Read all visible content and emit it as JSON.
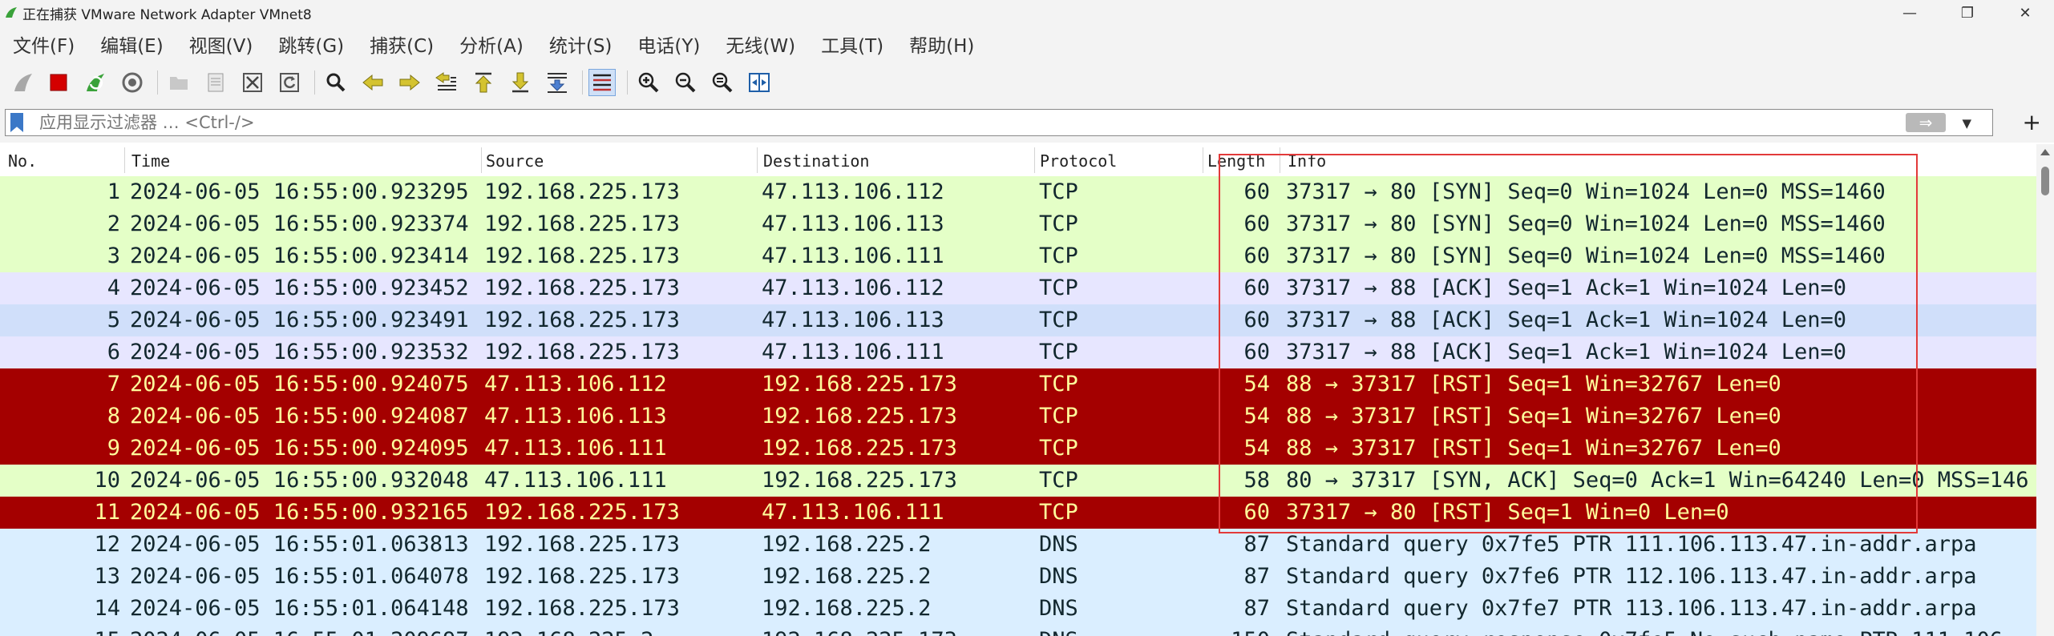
{
  "window": {
    "title": "正在捕获 VMware Network Adapter VMnet8",
    "controls": [
      "—",
      "❐",
      "✕"
    ]
  },
  "menu": {
    "items": [
      "文件(F)",
      "编辑(E)",
      "视图(V)",
      "跳转(G)",
      "捕获(C)",
      "分析(A)",
      "统计(S)",
      "电话(Y)",
      "无线(W)",
      "工具(T)",
      "帮助(H)"
    ]
  },
  "toolbar": {
    "icons": [
      "shark-fin-icon",
      "stop-icon",
      "restart-icon",
      "capture-options-icon",
      "open-folder-icon",
      "file-icon",
      "close-file-icon",
      "reload-icon",
      "search-icon",
      "back-arrow-icon",
      "forward-arrow-icon",
      "goto-packet-icon",
      "first-packet-icon",
      "last-packet-icon",
      "autoscroll-icon",
      "colorize-icon",
      "zoom-in-icon",
      "zoom-out-icon",
      "zoom-reset-icon",
      "resize-columns-icon"
    ]
  },
  "filter": {
    "placeholder": "应用显示过滤器 … <Ctrl-/>",
    "apply_label": "⇒",
    "add_label": "+"
  },
  "columns": {
    "no": "No.",
    "time": "Time",
    "source": "Source",
    "destination": "Destination",
    "protocol": "Protocol",
    "length": "Length",
    "info": "Info"
  },
  "colors": {
    "syn_bg": "#e4ffc7",
    "ack_bg": "#e7e6ff",
    "ack_selected_bg": "#d0dffa",
    "rst_bg": "#a40000",
    "rst_fg": "#fffc9c",
    "dns_bg": "#daeeff",
    "normal_fg": "#12272e",
    "highlight": "#e23a3a"
  },
  "packets": [
    {
      "no": "1",
      "time": "2024-06-05 16:55:00.923295",
      "src": "192.168.225.173",
      "dst": "47.113.106.112",
      "proto": "TCP",
      "len": "60",
      "info": "37317 → 80 [SYN] Seq=0 Win=1024 Len=0 MSS=1460",
      "bg": "#e4ffc7",
      "fg": "#12272e"
    },
    {
      "no": "2",
      "time": "2024-06-05 16:55:00.923374",
      "src": "192.168.225.173",
      "dst": "47.113.106.113",
      "proto": "TCP",
      "len": "60",
      "info": "37317 → 80 [SYN] Seq=0 Win=1024 Len=0 MSS=1460",
      "bg": "#e4ffc7",
      "fg": "#12272e"
    },
    {
      "no": "3",
      "time": "2024-06-05 16:55:00.923414",
      "src": "192.168.225.173",
      "dst": "47.113.106.111",
      "proto": "TCP",
      "len": "60",
      "info": "37317 → 80 [SYN] Seq=0 Win=1024 Len=0 MSS=1460",
      "bg": "#e4ffc7",
      "fg": "#12272e"
    },
    {
      "no": "4",
      "time": "2024-06-05 16:55:00.923452",
      "src": "192.168.225.173",
      "dst": "47.113.106.112",
      "proto": "TCP",
      "len": "60",
      "info": "37317 → 88 [ACK] Seq=1 Ack=1 Win=1024 Len=0",
      "bg": "#e7e6ff",
      "fg": "#12272e"
    },
    {
      "no": "5",
      "time": "2024-06-05 16:55:00.923491",
      "src": "192.168.225.173",
      "dst": "47.113.106.113",
      "proto": "TCP",
      "len": "60",
      "info": "37317 → 88 [ACK] Seq=1 Ack=1 Win=1024 Len=0",
      "bg": "#d0dffa",
      "fg": "#12272e"
    },
    {
      "no": "6",
      "time": "2024-06-05 16:55:00.923532",
      "src": "192.168.225.173",
      "dst": "47.113.106.111",
      "proto": "TCP",
      "len": "60",
      "info": "37317 → 88 [ACK] Seq=1 Ack=1 Win=1024 Len=0",
      "bg": "#e7e6ff",
      "fg": "#12272e"
    },
    {
      "no": "7",
      "time": "2024-06-05 16:55:00.924075",
      "src": "47.113.106.112",
      "dst": "192.168.225.173",
      "proto": "TCP",
      "len": "54",
      "info": "88 → 37317 [RST] Seq=1 Win=32767 Len=0",
      "bg": "#a40000",
      "fg": "#fffc9c"
    },
    {
      "no": "8",
      "time": "2024-06-05 16:55:00.924087",
      "src": "47.113.106.113",
      "dst": "192.168.225.173",
      "proto": "TCP",
      "len": "54",
      "info": "88 → 37317 [RST] Seq=1 Win=32767 Len=0",
      "bg": "#a40000",
      "fg": "#fffc9c"
    },
    {
      "no": "9",
      "time": "2024-06-05 16:55:00.924095",
      "src": "47.113.106.111",
      "dst": "192.168.225.173",
      "proto": "TCP",
      "len": "54",
      "info": "88 → 37317 [RST] Seq=1 Win=32767 Len=0",
      "bg": "#a40000",
      "fg": "#fffc9c"
    },
    {
      "no": "10",
      "time": "2024-06-05 16:55:00.932048",
      "src": "47.113.106.111",
      "dst": "192.168.225.173",
      "proto": "TCP",
      "len": "58",
      "info": "80 → 37317 [SYN, ACK] Seq=0 Ack=1 Win=64240 Len=0 MSS=146",
      "bg": "#e4ffc7",
      "fg": "#12272e"
    },
    {
      "no": "11",
      "time": "2024-06-05 16:55:00.932165",
      "src": "192.168.225.173",
      "dst": "47.113.106.111",
      "proto": "TCP",
      "len": "60",
      "info": "37317 → 80 [RST] Seq=1 Win=0 Len=0",
      "bg": "#a40000",
      "fg": "#fffc9c"
    },
    {
      "no": "12",
      "time": "2024-06-05 16:55:01.063813",
      "src": "192.168.225.173",
      "dst": "192.168.225.2",
      "proto": "DNS",
      "len": "87",
      "info": "Standard query 0x7fe5 PTR 111.106.113.47.in-addr.arpa",
      "bg": "#daeeff",
      "fg": "#12272e"
    },
    {
      "no": "13",
      "time": "2024-06-05 16:55:01.064078",
      "src": "192.168.225.173",
      "dst": "192.168.225.2",
      "proto": "DNS",
      "len": "87",
      "info": "Standard query 0x7fe6 PTR 112.106.113.47.in-addr.arpa",
      "bg": "#daeeff",
      "fg": "#12272e"
    },
    {
      "no": "14",
      "time": "2024-06-05 16:55:01.064148",
      "src": "192.168.225.173",
      "dst": "192.168.225.2",
      "proto": "DNS",
      "len": "87",
      "info": "Standard query 0x7fe7 PTR 113.106.113.47.in-addr.arpa",
      "bg": "#daeeff",
      "fg": "#12272e"
    },
    {
      "no": "15",
      "time": "2024-06-05 16:55:01.209697",
      "src": "192.168.225.2",
      "dst": "192.168.225.173",
      "proto": "DNS",
      "len": "150",
      "info": "Standard query response 0x7fe5 No such name PTR 111.106",
      "bg": "#daeeff",
      "fg": "#12272e"
    }
  ]
}
